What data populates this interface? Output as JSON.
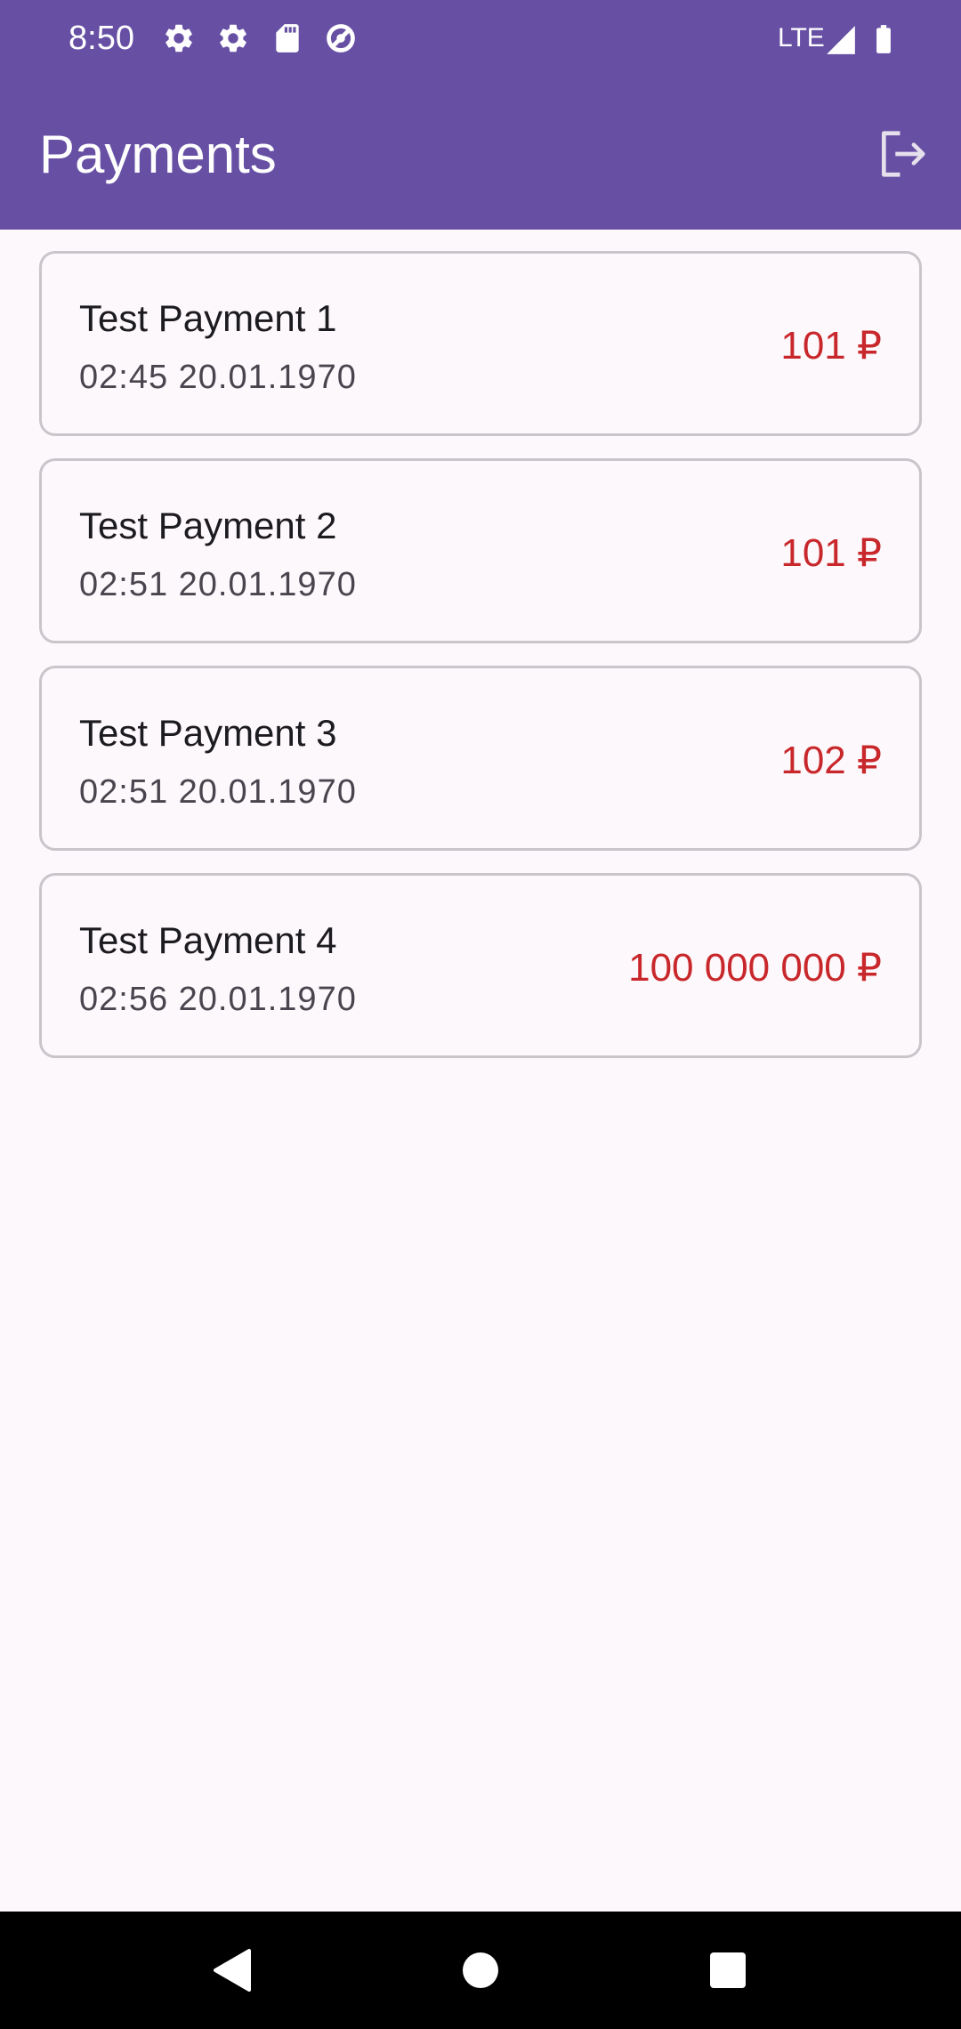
{
  "status_bar": {
    "time": "8:50",
    "network": "LTE",
    "icons": [
      "gear-icon",
      "gear-icon",
      "sd-card-icon",
      "data-saver-icon",
      "signal-icon",
      "battery-icon"
    ]
  },
  "app_bar": {
    "title": "Payments",
    "action_icon": "logout-icon"
  },
  "payments": [
    {
      "title": "Test Payment 1",
      "datetime": "02:45 20.01.1970",
      "amount": "101 ₽"
    },
    {
      "title": "Test Payment 2",
      "datetime": "02:51 20.01.1970",
      "amount": "101 ₽"
    },
    {
      "title": "Test Payment 3",
      "datetime": "02:51 20.01.1970",
      "amount": "102 ₽"
    },
    {
      "title": "Test Payment 4",
      "datetime": "02:56 20.01.1970",
      "amount": "100 000 000 ₽"
    }
  ],
  "nav_bar": {
    "buttons": [
      "back-icon",
      "home-icon",
      "recents-icon"
    ]
  },
  "colors": {
    "primary": "#6750a4",
    "amount": "#c8282b",
    "background": "#fdf8fc",
    "card_border": "#c9c5ca"
  }
}
